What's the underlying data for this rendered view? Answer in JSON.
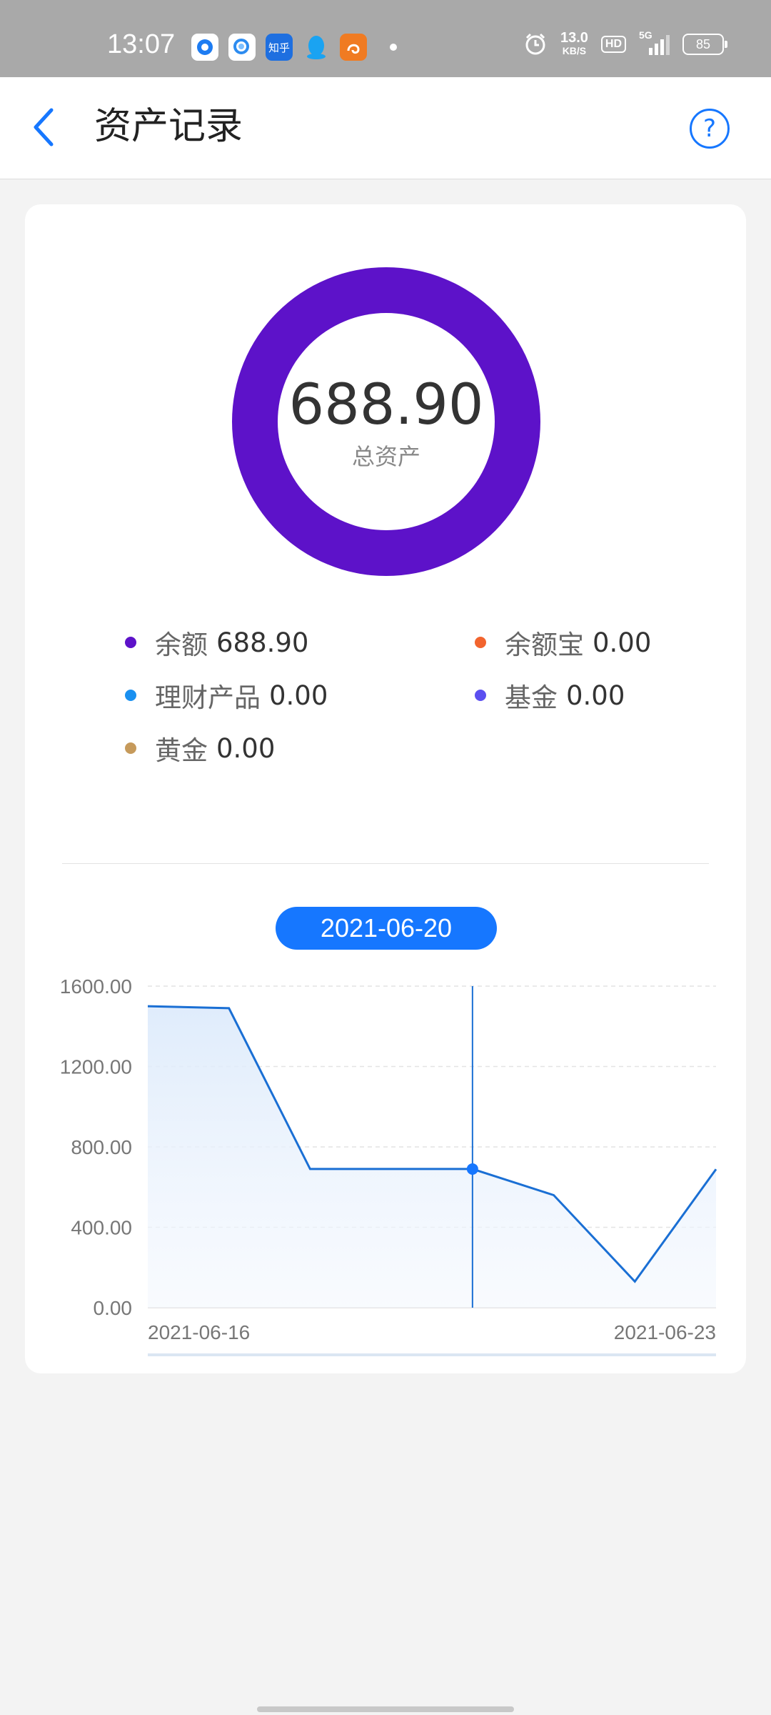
{
  "status_bar": {
    "time": "13:07",
    "apps": [
      {
        "icon": "browser-app-icon",
        "color": "#ffffff"
      },
      {
        "icon": "search-app-icon",
        "color": "#ffffff"
      },
      {
        "icon": "zhihu-app-icon",
        "label": "知乎",
        "color": "#1e6fe0"
      },
      {
        "icon": "qq-app-icon",
        "color": "#1aa3f2"
      },
      {
        "icon": "uc-browser-app-icon",
        "color": "#f07b22"
      }
    ],
    "net_speed": "13.0",
    "net_speed_unit": "KB/S",
    "hd": "HD",
    "network": "5G",
    "battery": "85"
  },
  "header": {
    "title": "资产记录"
  },
  "summary": {
    "total_value": "688.90",
    "total_label": "总资产",
    "ring_color": "#5d12c9"
  },
  "legend": [
    {
      "name": "余额",
      "value": "688.90",
      "color": "#5d12c9"
    },
    {
      "name": "余额宝",
      "value": "0.00",
      "color": "#f2642e"
    },
    {
      "name": "理财产品",
      "value": "0.00",
      "color": "#1a90f0"
    },
    {
      "name": "基金",
      "value": "0.00",
      "color": "#5b4ff0"
    },
    {
      "name": "黄金",
      "value": "0.00",
      "color": "#c69a5b"
    }
  ],
  "chart_data": {
    "type": "area",
    "selected_date": "2021-06-20",
    "x_start_label": "2021-06-16",
    "x_end_label": "2021-06-23",
    "x": [
      "2021-06-16",
      "2021-06-17",
      "2021-06-18",
      "2021-06-19",
      "2021-06-20",
      "2021-06-21",
      "2021-06-22",
      "2021-06-23"
    ],
    "values": [
      1500,
      1490,
      690,
      690,
      690,
      560,
      130,
      688.9
    ],
    "yticks": [
      "1600.00",
      "1200.00",
      "800.00",
      "400.00",
      "0.00"
    ],
    "ylim": [
      0,
      1600
    ],
    "selected_index": 4,
    "line_color": "#1a6fd4",
    "grid": true
  }
}
